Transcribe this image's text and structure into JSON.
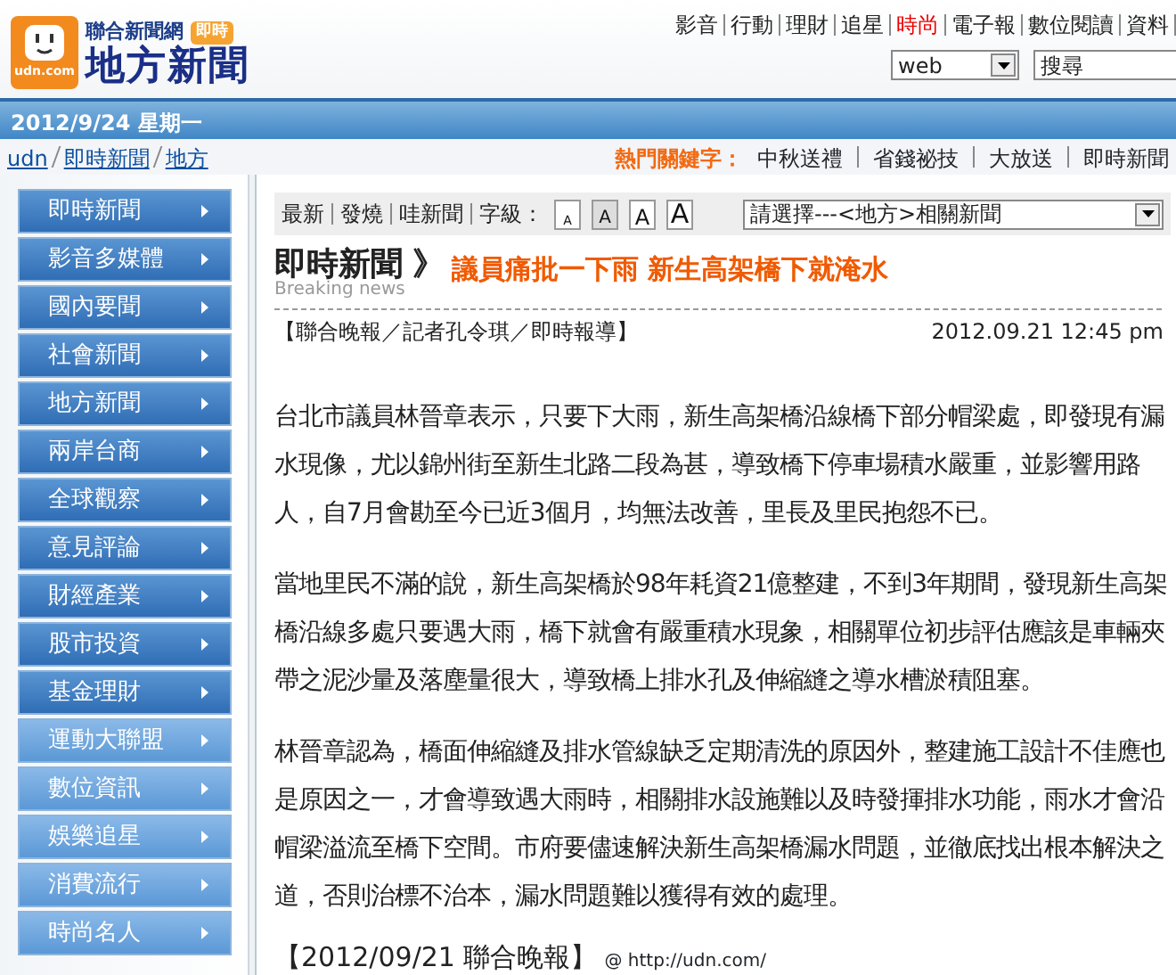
{
  "logo": {
    "domain": "udn.com",
    "network": "聯合新聞網",
    "badge": "即時",
    "section": "地方新聞"
  },
  "top_links": [
    {
      "label": "影音",
      "highlight": false
    },
    {
      "label": "行動",
      "highlight": false
    },
    {
      "label": "理財",
      "highlight": false
    },
    {
      "label": "追星",
      "highlight": false
    },
    {
      "label": "時尚",
      "highlight": true
    },
    {
      "label": "電子報",
      "highlight": false
    },
    {
      "label": "數位閱讀",
      "highlight": false
    },
    {
      "label": "資料",
      "highlight": false
    }
  ],
  "search": {
    "scope": "web",
    "value": "搜尋"
  },
  "date_bar": "2012/9/24 星期一",
  "breadcrumb": [
    "udn",
    "即時新聞",
    "地方"
  ],
  "hot_keywords": {
    "label": "熱門關鍵字：",
    "items": [
      "中秋送禮",
      "省錢祕技",
      "大放送",
      "即時新聞"
    ]
  },
  "sidebar": {
    "items": [
      {
        "label": "即時新聞",
        "kind": "primary"
      },
      {
        "label": "影音多媒體",
        "kind": "primary"
      },
      {
        "label": "國內要聞",
        "kind": "primary"
      },
      {
        "label": "社會新聞",
        "kind": "primary"
      },
      {
        "label": "地方新聞",
        "kind": "primary"
      },
      {
        "label": "兩岸台商",
        "kind": "primary"
      },
      {
        "label": "全球觀察",
        "kind": "primary"
      },
      {
        "label": "意見評論",
        "kind": "primary"
      },
      {
        "label": "財經產業",
        "kind": "primary"
      },
      {
        "label": "股市投資",
        "kind": "primary"
      },
      {
        "label": "基金理財",
        "kind": "primary"
      },
      {
        "label": "運動大聯盟",
        "kind": "secondary"
      },
      {
        "label": "數位資訊",
        "kind": "secondary"
      },
      {
        "label": "娛樂追星",
        "kind": "secondary"
      },
      {
        "label": "消費流行",
        "kind": "secondary"
      },
      {
        "label": "時尚名人",
        "kind": "secondary"
      }
    ]
  },
  "toolbar": {
    "links": [
      "最新",
      "發燒",
      "哇新聞"
    ],
    "font_label": "字級：",
    "font_sizes": [
      {
        "label": "A",
        "selected": false
      },
      {
        "label": "A",
        "selected": true
      },
      {
        "label": "A",
        "selected": false
      },
      {
        "label": "A",
        "selected": false
      }
    ],
    "related_select": "請選擇---<地方>相關新聞"
  },
  "article": {
    "section": "即時新聞",
    "section_en": "Breaking news",
    "separator": "》",
    "title": "議員痛批一下雨 新生高架橋下就淹水",
    "byline": "【聯合晚報／記者孔令琪／即時報導】",
    "timestamp": "2012.09.21 12:45 pm",
    "paragraphs": [
      "台北市議員林晉章表示，只要下大雨，新生高架橋沿線橋下部分帽梁處，即發現有漏水現像，尤以錦州街至新生北路二段為甚，導致橋下停車場積水嚴重，並影響用路人，自7月會勘至今已近3個月，均無法改善，里長及里民抱怨不已。",
      "當地里民不滿的說，新生高架橋於98年耗資21億整建，不到3年期間，發現新生高架橋沿線多處只要遇大雨，橋下就會有嚴重積水現象，相關單位初步評估應該是車輛夾帶之泥沙量及落塵量很大，導致橋上排水孔及伸縮縫之導水槽淤積阻塞。",
      "林晉章認為，橋面伸縮縫及排水管線缺乏定期清洗的原因外，整建施工設計不佳應也是原因之一，才會導致遇大雨時，相關排水設施難以及時發揮排水功能，雨水才會沿帽梁溢流至橋下空間。市府要儘速解決新生高架橋漏水問題，並徹底找出根本解決之道，否則治標不治本，漏水問題難以獲得有效的處理。"
    ],
    "source": "【2012/09/21 聯合晚報】",
    "source_link": "@ http://udn.com/"
  }
}
